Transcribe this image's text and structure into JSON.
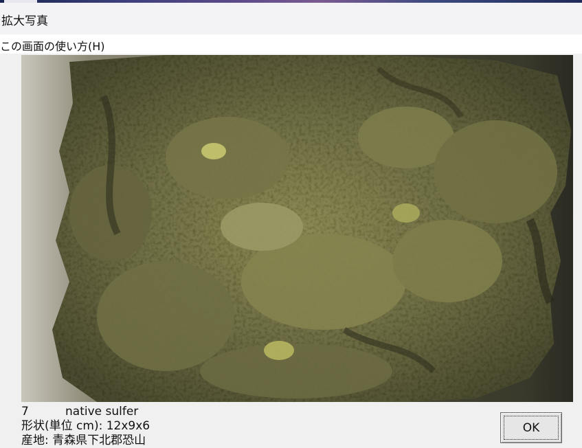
{
  "window": {
    "title": "拡大写真"
  },
  "menu": {
    "help_label": "この画面の使い方(H)"
  },
  "photo": {
    "subject": "native sulfur mineral specimen photograph",
    "colors": {
      "matrix": "#5c5c3a",
      "crystal": "#8a8a4a",
      "highlight": "#c8c870",
      "background_left": "#c9c6bd",
      "background_right": "#2a2a22"
    }
  },
  "specimen": {
    "number": "7",
    "name": "native sulfer",
    "shape_line": "形状(単位 cm): 12x9x6",
    "locality_line": "産地: 青森県下北郡恐山"
  },
  "buttons": {
    "ok_label": "OK"
  }
}
